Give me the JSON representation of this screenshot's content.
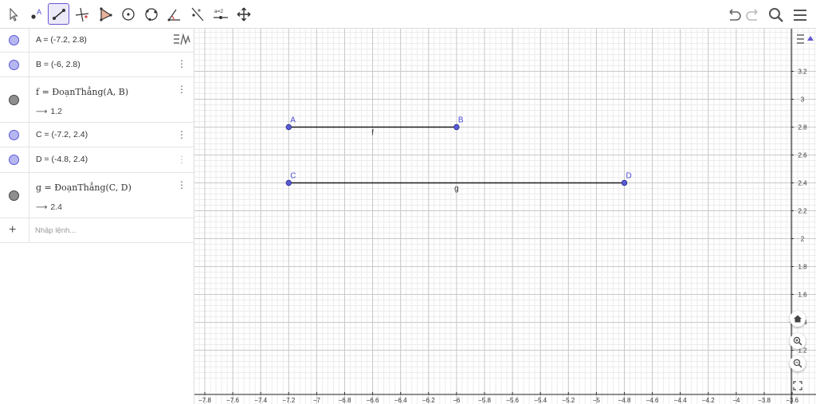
{
  "toolbar": {
    "tools": [
      {
        "name": "move-tool-icon",
        "active": false
      },
      {
        "name": "point-tool-icon",
        "label": "A",
        "active": false
      },
      {
        "name": "segment-tool-icon",
        "active": true
      },
      {
        "name": "perpendicular-line-tool-icon",
        "active": false
      },
      {
        "name": "polygon-tool-icon",
        "active": false
      },
      {
        "name": "circle-center-point-tool-icon",
        "active": false
      },
      {
        "name": "circle-three-points-tool-icon",
        "active": false
      },
      {
        "name": "angle-tool-icon",
        "active": false
      },
      {
        "name": "reflect-line-tool-icon",
        "active": false
      },
      {
        "name": "slider-tool-icon",
        "label": "a=2",
        "active": false
      },
      {
        "name": "move-graphics-view-tool-icon",
        "active": false
      }
    ],
    "right": [
      "undo-icon",
      "redo-icon",
      "search-icon",
      "menu-icon"
    ]
  },
  "algebra": {
    "items": [
      {
        "kind": "point",
        "expr": "A = (-7.2, 2.8)"
      },
      {
        "kind": "point",
        "expr": "B = (-6, 2.8)"
      },
      {
        "kind": "segment",
        "expr": "f = ĐoạnThẳng(A, B)",
        "value": "1.2"
      },
      {
        "kind": "point",
        "expr": "C = (-7.2, 2.4)"
      },
      {
        "kind": "point",
        "expr": "D = (-4.8, 2.4)"
      },
      {
        "kind": "segment",
        "expr": "g = ĐoạnThẳng(C, D)",
        "value": "2.4"
      }
    ],
    "input_placeholder": "Nhập lệnh..."
  },
  "colors": {
    "point_fill": "#5a5ad6",
    "point_label": "#4a4ad0",
    "segment": "#1a1a1a",
    "active_tool": "#6557d2",
    "grid_major": "#c9c9c9",
    "grid_minor": "#ececec"
  },
  "graphics": {
    "x_range": [
      -7.8,
      -3.6
    ],
    "y_range": [
      1.1,
      3.4
    ],
    "x_ticks": [
      "-7.8",
      "-7.6",
      "-7.4",
      "-7.2",
      "-7",
      "-6.8",
      "-6.6",
      "-6.4",
      "-6.2",
      "-6",
      "-5.8",
      "-5.6",
      "-5.4",
      "-5.2",
      "-5",
      "-4.8",
      "-4.6",
      "-4.4",
      "-4.2",
      "-4",
      "-3.8",
      "-3.6"
    ],
    "y_ticks": [
      "1.2",
      "1.4",
      "1.6",
      "1.8",
      "2",
      "2.2",
      "2.4",
      "2.6",
      "2.8",
      "3",
      "3.2"
    ],
    "points": [
      {
        "name": "A",
        "x": -7.2,
        "y": 2.8
      },
      {
        "name": "B",
        "x": -6,
        "y": 2.8
      },
      {
        "name": "C",
        "x": -7.2,
        "y": 2.4
      },
      {
        "name": "D",
        "x": -4.8,
        "y": 2.4
      }
    ],
    "segments": [
      {
        "name": "f",
        "from": "A",
        "to": "B"
      },
      {
        "name": "g",
        "from": "C",
        "to": "D"
      }
    ],
    "buttons": [
      "home-icon",
      "zoom-in-icon",
      "zoom-out-icon",
      "fullscreen-icon"
    ]
  }
}
